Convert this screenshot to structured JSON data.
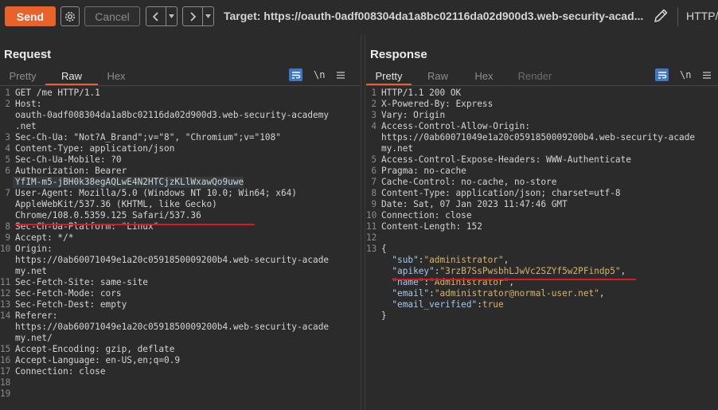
{
  "toolbar": {
    "send_label": "Send",
    "cancel_label": "Cancel",
    "back_glyph": "<",
    "forward_glyph": ">",
    "dropdown_glyph": "▾",
    "target_label": "Target: https://oauth-0adf008304da1a8bc02116da02d900d3.web-security-acad...",
    "protocol_label": "HTTP/"
  },
  "request": {
    "title": "Request",
    "tabs": [
      "Pretty",
      "Raw",
      "Hex"
    ],
    "active_tab": "Raw",
    "newline_toggle": "\\n",
    "lines": [
      {
        "n": "1",
        "t": "GET /me HTTP/1.1"
      },
      {
        "n": "2",
        "t": "Host:"
      },
      {
        "n": "",
        "t": "oauth-0adf008304da1a8bc02116da02d900d3.web-security-academy"
      },
      {
        "n": "",
        "t": ".net"
      },
      {
        "n": "3",
        "t": "Sec-Ch-Ua: \"Not?A_Brand\";v=\"8\", \"Chromium\";v=\"108\""
      },
      {
        "n": "4",
        "t": "Content-Type: application/json"
      },
      {
        "n": "5",
        "t": "Sec-Ch-Ua-Mobile: ?0"
      },
      {
        "n": "6",
        "t": "Authorization: Bearer"
      },
      {
        "n": "",
        "t": "YfIM-m5-jBH0k38egAQLwE4N2HTCjzKLlWxawQo9uwe",
        "hl": true
      },
      {
        "n": "7",
        "t": "User-Agent: Mozilla/5.0 (Windows NT 10.0; Win64; x64)"
      },
      {
        "n": "",
        "t": "AppleWebKit/537.36 (KHTML, like Gecko)"
      },
      {
        "n": "",
        "t": "Chrome/108.0.5359.125 Safari/537.36"
      },
      {
        "n": "8",
        "t": "Sec-Ch-Ua-Platform: \"Linux\""
      },
      {
        "n": "9",
        "t": "Accept: */*"
      },
      {
        "n": "10",
        "t": "Origin:"
      },
      {
        "n": "",
        "t": "https://0ab60071049e1a20c0591850009200b4.web-security-acade"
      },
      {
        "n": "",
        "t": "my.net"
      },
      {
        "n": "11",
        "t": "Sec-Fetch-Site: same-site"
      },
      {
        "n": "12",
        "t": "Sec-Fetch-Mode: cors"
      },
      {
        "n": "13",
        "t": "Sec-Fetch-Dest: empty"
      },
      {
        "n": "14",
        "t": "Referer:"
      },
      {
        "n": "",
        "t": "https://0ab60071049e1a20c0591850009200b4.web-security-acade"
      },
      {
        "n": "",
        "t": "my.net/"
      },
      {
        "n": "15",
        "t": "Accept-Encoding: gzip, deflate"
      },
      {
        "n": "16",
        "t": "Accept-Language: en-US,en;q=0.9"
      },
      {
        "n": "17",
        "t": "Connection: close"
      },
      {
        "n": "18",
        "t": ""
      },
      {
        "n": "19",
        "t": ""
      }
    ]
  },
  "response": {
    "title": "Response",
    "tabs": [
      "Pretty",
      "Raw",
      "Hex",
      "Render"
    ],
    "active_tab": "Pretty",
    "newline_toggle": "\\n",
    "lines": [
      {
        "n": "1",
        "t": "HTTP/1.1 200 OK"
      },
      {
        "n": "2",
        "t": "X-Powered-By: Express"
      },
      {
        "n": "3",
        "t": "Vary: Origin"
      },
      {
        "n": "4",
        "t": "Access-Control-Allow-Origin:"
      },
      {
        "n": "",
        "t": "https://0ab60071049e1a20c0591850009200b4.web-security-acade"
      },
      {
        "n": "",
        "t": "my.net"
      },
      {
        "n": "5",
        "t": "Access-Control-Expose-Headers: WWW-Authenticate"
      },
      {
        "n": "6",
        "t": "Pragma: no-cache"
      },
      {
        "n": "7",
        "t": "Cache-Control: no-cache, no-store"
      },
      {
        "n": "8",
        "t": "Content-Type: application/json; charset=utf-8"
      },
      {
        "n": "9",
        "t": "Date: Sat, 07 Jan 2023 11:47:46 GMT"
      },
      {
        "n": "10",
        "t": "Connection: close"
      },
      {
        "n": "11",
        "t": "Content-Length: 152"
      },
      {
        "n": "12",
        "t": ""
      },
      {
        "n": "13",
        "t": "{"
      },
      {
        "n": "",
        "json": true,
        "k": "sub",
        "v": "administrator",
        "comma": true
      },
      {
        "n": "",
        "json": true,
        "k": "apikey",
        "v": "3rzB7SsPwsbhLJwVc2SZYf5w2PFindp5",
        "comma": true
      },
      {
        "n": "",
        "json": true,
        "k": "name",
        "v": "Administrator",
        "comma": true
      },
      {
        "n": "",
        "json": true,
        "k": "email",
        "v": "administrator@normal-user.net",
        "comma": true
      },
      {
        "n": "",
        "json": true,
        "k": "email_verified",
        "v": "true",
        "bool": true,
        "comma": false
      },
      {
        "n": "",
        "t": "}"
      }
    ]
  },
  "colors": {
    "accent": "#e8622c",
    "highlight_underline": "#e21818",
    "active_toggle": "#4a7cc9"
  }
}
